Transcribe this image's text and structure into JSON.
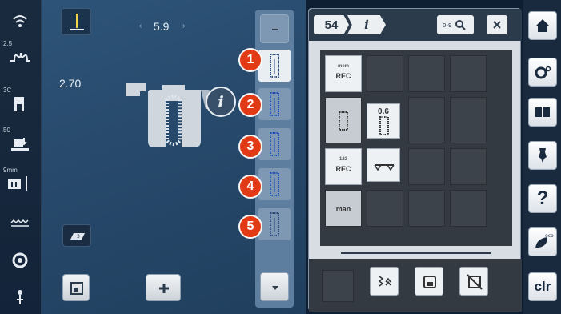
{
  "left_bar": {
    "upper_thread_tension_value": "2.5",
    "presser_foot_indicator_value": "3C",
    "presser_foot_pressure_value": "50",
    "needle_indicator_value": "9mm"
  },
  "main": {
    "stitch_width": "5.9",
    "stitch_length": "2.70",
    "badges": [
      "1",
      "2",
      "3",
      "4",
      "5"
    ]
  },
  "panel": {
    "stitch_number": "54",
    "info_tab": "i",
    "cells": {
      "rec_memory_label": "REC",
      "rec_memory_top": "mem",
      "count_value": "0.6",
      "rec_count_label": "REC",
      "rec_count_top": "123",
      "man_label": "man"
    }
  },
  "right_bar": {
    "clr_label": "clr"
  },
  "colors": {
    "badge_red": "#e23a15",
    "panel_header": "#2c3b4b",
    "main_bg": "#27496b"
  }
}
